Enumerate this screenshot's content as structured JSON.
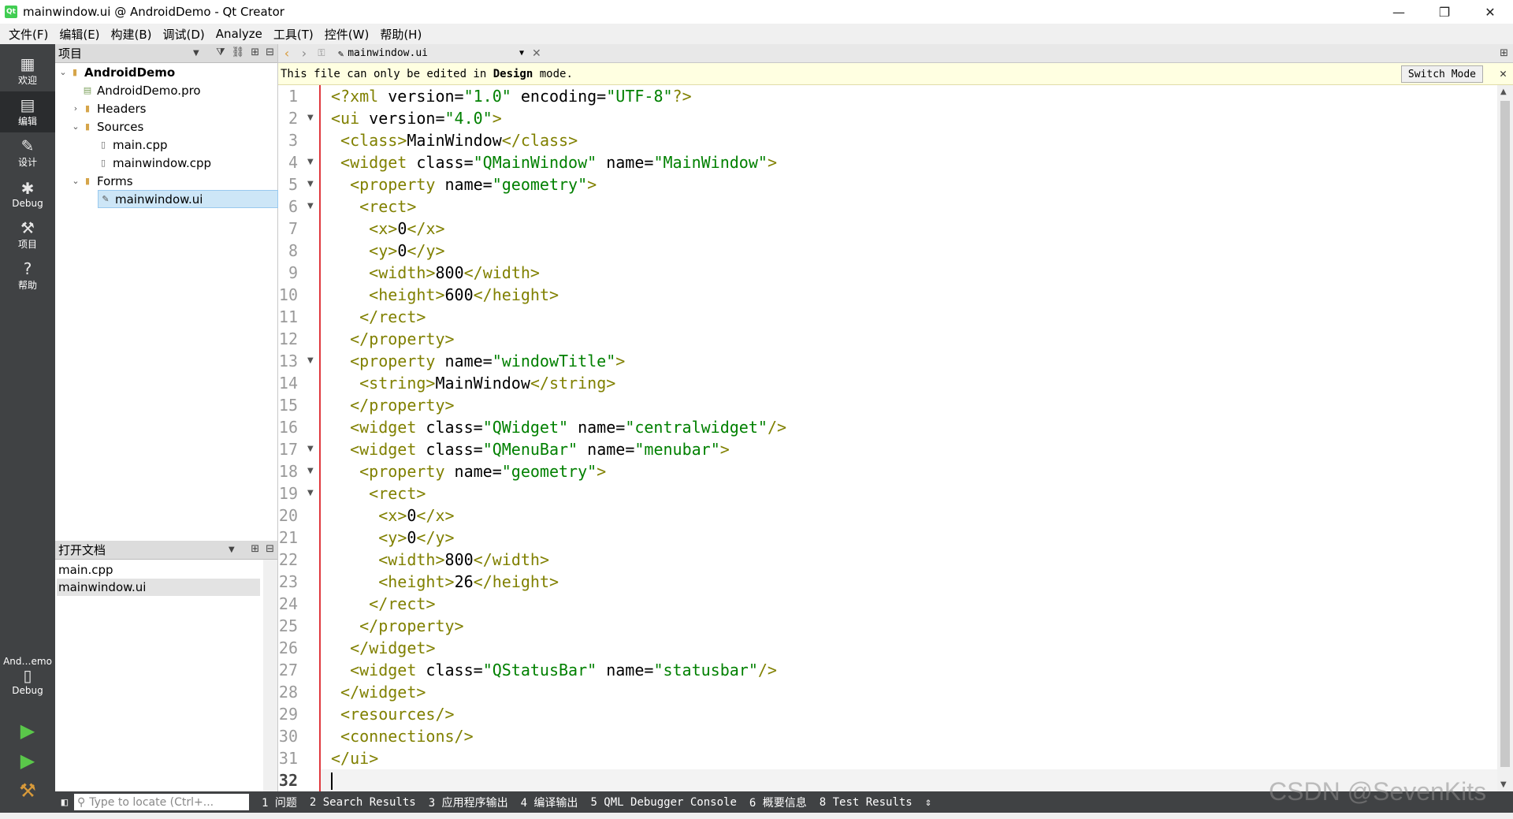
{
  "window": {
    "title": "mainwindow.ui @ AndroidDemo - Qt Creator",
    "app_icon_text": "Qt",
    "controls": [
      "—",
      "❐",
      "✕"
    ]
  },
  "menubar": [
    "文件(F)",
    "编辑(E)",
    "构建(B)",
    "调试(D)",
    "Analyze",
    "工具(T)",
    "控件(W)",
    "帮助(H)"
  ],
  "modes": [
    {
      "icon": "grid-icon",
      "label": "欢迎"
    },
    {
      "icon": "edit-icon",
      "label": "编辑"
    },
    {
      "icon": "pencil-icon",
      "label": "设计"
    },
    {
      "icon": "bug-icon",
      "label": "Debug"
    },
    {
      "icon": "wrench-icon",
      "label": "项目"
    },
    {
      "icon": "help-icon",
      "label": "帮助"
    }
  ],
  "kit": {
    "name": "And…emo",
    "mode": "Debug"
  },
  "project_panel": {
    "title": "项目",
    "tree": [
      {
        "label": "AndroidDemo",
        "bold": true
      },
      {
        "label": "AndroidDemo.pro"
      },
      {
        "label": "Headers"
      },
      {
        "label": "Sources"
      },
      {
        "label": "main.cpp"
      },
      {
        "label": "mainwindow.cpp"
      },
      {
        "label": "Forms"
      },
      {
        "label": "mainwindow.ui",
        "selected": true
      }
    ]
  },
  "open_docs": {
    "title": "打开文档",
    "items": [
      "main.cpp",
      "mainwindow.ui"
    ],
    "selected": "mainwindow.ui"
  },
  "editor": {
    "file": "mainwindow.ui",
    "info": {
      "prefix": "This file can only be edited in ",
      "mode": "Design",
      "suffix": " mode.",
      "button": "Switch Mode"
    },
    "lines": [
      "<?xml version=\"1.0\" encoding=\"UTF-8\"?>",
      "<ui version=\"4.0\">",
      " <class>MainWindow</class>",
      " <widget class=\"QMainWindow\" name=\"MainWindow\">",
      "  <property name=\"geometry\">",
      "   <rect>",
      "    <x>0</x>",
      "    <y>0</y>",
      "    <width>800</width>",
      "    <height>600</height>",
      "   </rect>",
      "  </property>",
      "  <property name=\"windowTitle\">",
      "   <string>MainWindow</string>",
      "  </property>",
      "  <widget class=\"QWidget\" name=\"centralwidget\"/>",
      "  <widget class=\"QMenuBar\" name=\"menubar\">",
      "   <property name=\"geometry\">",
      "    <rect>",
      "     <x>0</x>",
      "     <y>0</y>",
      "     <width>800</width>",
      "     <height>26</height>",
      "    </rect>",
      "   </property>",
      "  </widget>",
      "  <widget class=\"QStatusBar\" name=\"statusbar\"/>",
      " </widget>",
      " <resources/>",
      " <connections/>",
      "</ui>",
      ""
    ],
    "fold_lines": [
      2,
      4,
      5,
      6,
      13,
      17,
      18,
      19
    ]
  },
  "bottom": {
    "locator_placeholder": "Type to locate (Ctrl+...",
    "tabs": [
      "1 问题",
      "2 Search Results",
      "3 应用程序输出",
      "4 编译输出",
      "5 QML Debugger Console",
      "6 概要信息",
      "8 Test Results"
    ]
  },
  "watermark": "CSDN @SevenKits"
}
